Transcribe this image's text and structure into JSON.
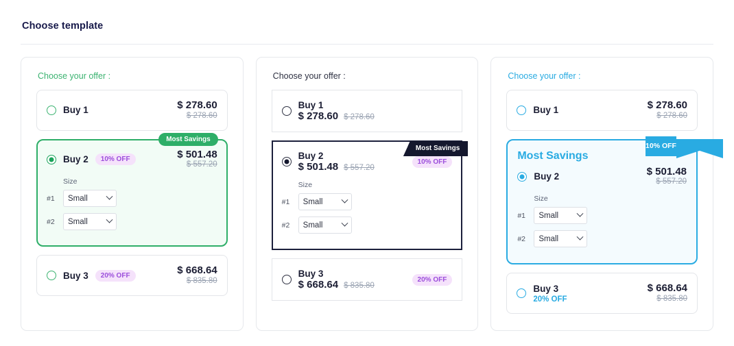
{
  "header": {
    "title": "Choose template"
  },
  "offer_heading": "Choose your offer :",
  "labels": {
    "size": "Size",
    "most_savings": "Most Savings",
    "slot1": "#1",
    "slot2": "#2",
    "select_value": "Small",
    "caret_icon": "chevron-down-icon"
  },
  "colors": {
    "green": "#2eae68",
    "navy": "#15182e",
    "cyan": "#29abe2",
    "pill_bg": "#f5e2fb",
    "pill_text": "#9b4ddb",
    "old_price": "#9aa3b2"
  },
  "offers": {
    "buy1": {
      "qty": "Buy 1",
      "price": "$ 278.60",
      "old_price": "$ 278.60",
      "discount": ""
    },
    "buy2": {
      "qty": "Buy 2",
      "price": "$ 501.48",
      "old_price": "$ 557.20",
      "discount": "10% OFF"
    },
    "buy3": {
      "qty": "Buy 3",
      "price": "$ 668.64",
      "old_price": "$ 835.80",
      "discount": "20% OFF"
    }
  },
  "templates": [
    {
      "id": "template-1",
      "accent": "#2eae68",
      "badge_style": "pill"
    },
    {
      "id": "template-2",
      "accent": "#15182e",
      "badge_style": "ribbon"
    },
    {
      "id": "template-3",
      "accent": "#29abe2",
      "badge_style": "flag"
    }
  ]
}
